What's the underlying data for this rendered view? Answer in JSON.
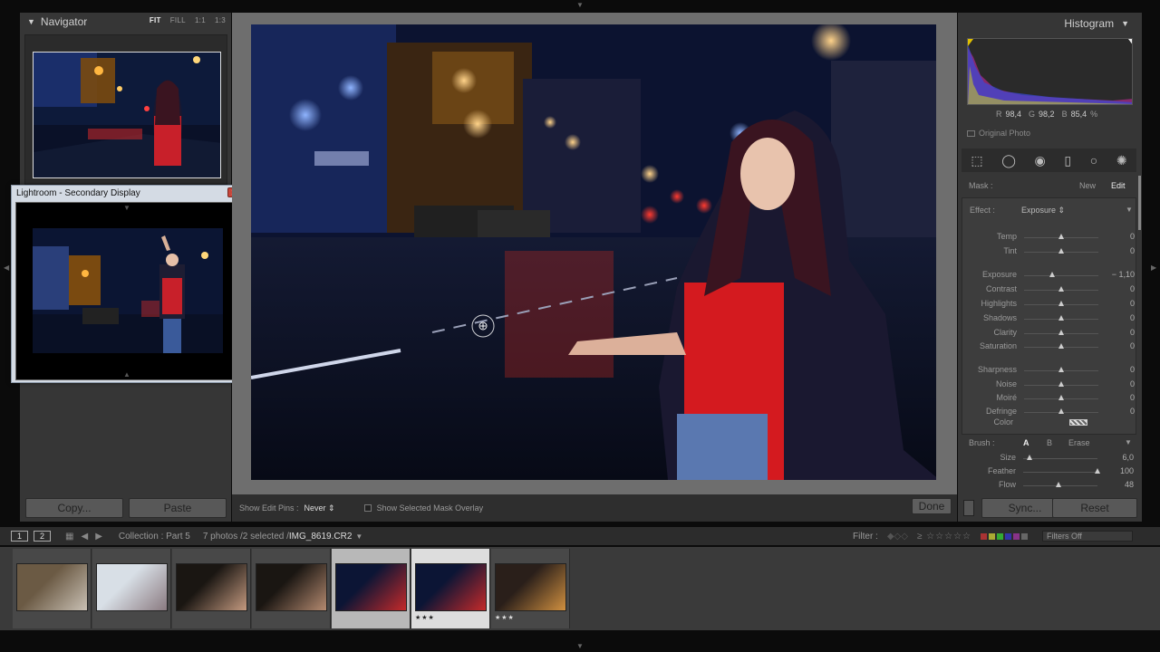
{
  "navigator": {
    "title": "Navigator",
    "zoom": [
      "FIT",
      "FILL",
      "1:1",
      "1:3"
    ]
  },
  "left_buttons": {
    "copy": "Copy...",
    "paste": "Paste"
  },
  "secondary": {
    "title": "Lightroom - Secondary Display",
    "close": "x"
  },
  "toolbar": {
    "edit_pins_label": "Show Edit Pins :",
    "edit_pins_value": "Never",
    "mask_overlay_label": "Show Selected Mask Overlay",
    "done": "Done"
  },
  "histogram": {
    "title": "Histogram",
    "rgb_r": "R",
    "rgb_r_val": "98,4",
    "rgb_g": "G",
    "rgb_g_val": "98,2",
    "rgb_b": "B",
    "rgb_b_val": "85,4",
    "rgb_unit": "%",
    "original_photo": "Original Photo"
  },
  "mask": {
    "label": "Mask :",
    "new": "New",
    "edit": "Edit"
  },
  "effect": {
    "label": "Effect :",
    "value": "Exposure"
  },
  "sliders": [
    {
      "name": "Temp",
      "value": "0",
      "pos": 0.5
    },
    {
      "name": "Tint",
      "value": "0",
      "pos": 0.5
    },
    {
      "name": "Exposure",
      "value": "− 1,10",
      "pos": 0.38
    },
    {
      "name": "Contrast",
      "value": "0",
      "pos": 0.5
    },
    {
      "name": "Highlights",
      "value": "0",
      "pos": 0.5
    },
    {
      "name": "Shadows",
      "value": "0",
      "pos": 0.5
    },
    {
      "name": "Clarity",
      "value": "0",
      "pos": 0.5
    },
    {
      "name": "Saturation",
      "value": "0",
      "pos": 0.5
    },
    {
      "name": "Sharpness",
      "value": "0",
      "pos": 0.5
    },
    {
      "name": "Noise",
      "value": "0",
      "pos": 0.5
    },
    {
      "name": "Moiré",
      "value": "0",
      "pos": 0.5
    },
    {
      "name": "Defringe",
      "value": "0",
      "pos": 0.5
    }
  ],
  "color_label": "Color",
  "brush": {
    "label": "Brush :",
    "a": "A",
    "b": "B",
    "erase": "Erase",
    "sliders": [
      {
        "name": "Size",
        "value": "6,0",
        "pos": 0.08
      },
      {
        "name": "Feather",
        "value": "100",
        "pos": 1.0
      },
      {
        "name": "Flow",
        "value": "48",
        "pos": 0.48
      }
    ]
  },
  "right_buttons": {
    "sync": "Sync...",
    "reset": "Reset"
  },
  "filmstrip_bar": {
    "screen1": "1",
    "screen2": "2",
    "collection": "Collection : Part 5",
    "count": "7 photos /2 selected /",
    "filename": "IMG_8619.CR2",
    "filter_label": "Filter :",
    "filters_off": "Filters Off"
  },
  "filmstrip": [
    {
      "stars": "",
      "selected": false
    },
    {
      "stars": "",
      "selected": false
    },
    {
      "stars": "",
      "selected": false
    },
    {
      "stars": "",
      "selected": false
    },
    {
      "stars": "",
      "selected": true
    },
    {
      "stars": "★★★",
      "selected": true
    },
    {
      "stars": "★★★",
      "selected": false
    }
  ],
  "colors": {
    "panel": "#363636",
    "accent": "#cfcfcf"
  }
}
